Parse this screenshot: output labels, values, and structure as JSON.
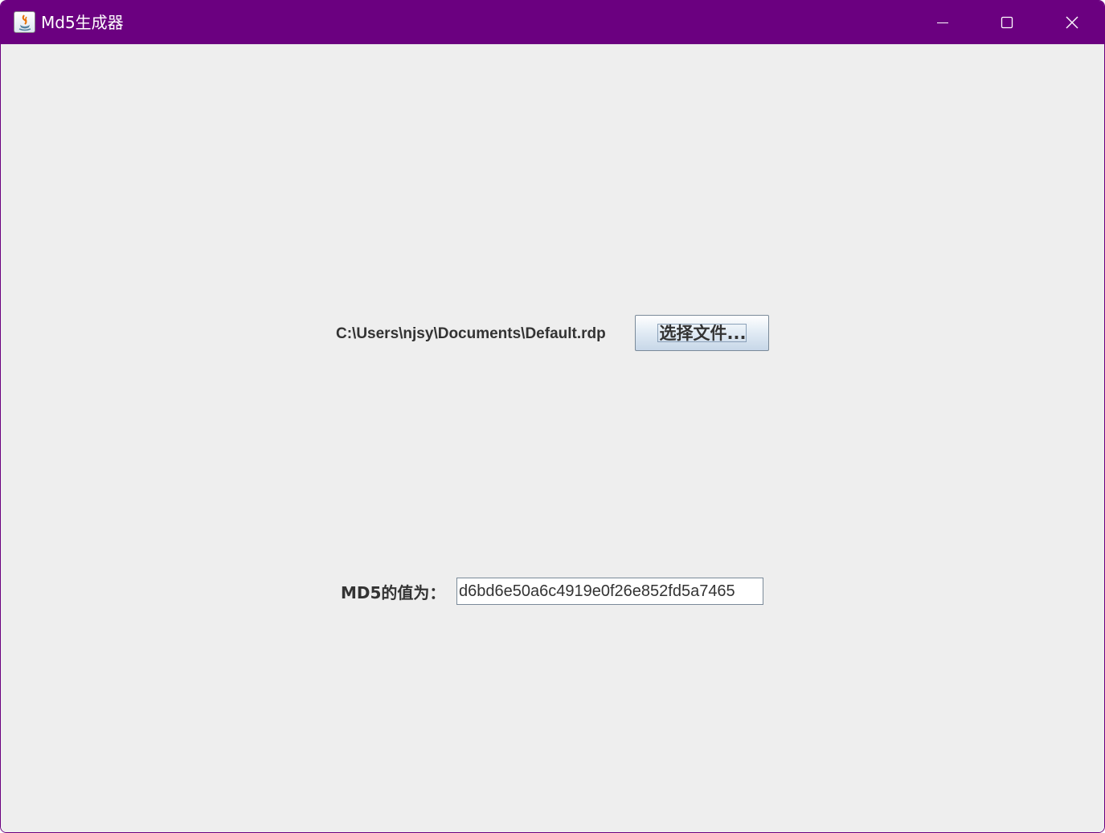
{
  "window": {
    "title": "Md5生成器",
    "accent_color": "#6b0080",
    "background_color": "#eeeeee",
    "icons": {
      "app": "java-app-icon",
      "minimize": "minimize-icon",
      "maximize": "maximize-icon",
      "close": "close-icon"
    }
  },
  "file": {
    "path": "C:\\Users\\njsy\\Documents\\Default.rdp",
    "choose_button_label": "选择文件..."
  },
  "md5": {
    "label": "MD5的值为：",
    "value": "d6bd6e50a6c4919e0f26e852fd5a7465"
  }
}
